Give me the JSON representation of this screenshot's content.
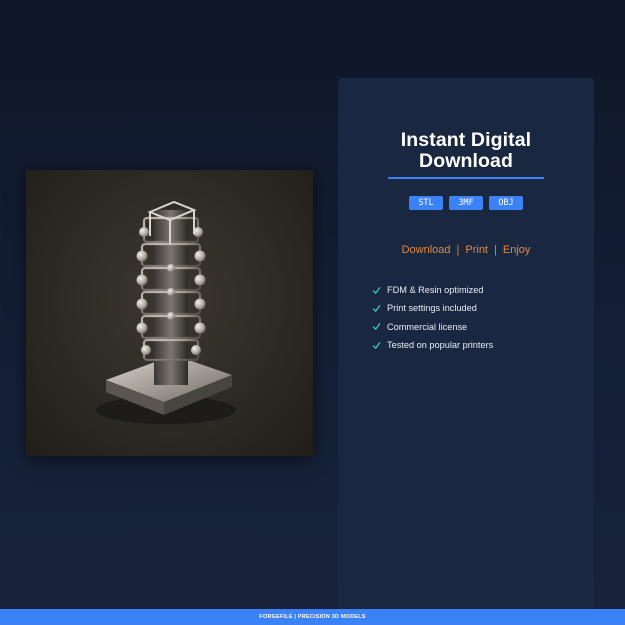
{
  "product_image": {
    "alt": "3D printed lattice tower model"
  },
  "card": {
    "title_line1": "Instant Digital",
    "title_line2": "Download",
    "formats": [
      "STL",
      "3MF",
      "OBJ"
    ],
    "actions": [
      "Download",
      "Print",
      "Enjoy"
    ],
    "features": [
      "FDM & Resin optimized",
      "Print settings included",
      "Commercial license",
      "Tested on popular printers"
    ]
  },
  "footer": {
    "text": "FORGEFILE | PRECISION 3D MODELS"
  },
  "colors": {
    "accent_blue": "#3b82f6",
    "accent_orange": "#e3883a",
    "check_teal": "#2dd4bf",
    "card_bg": "#1a2740",
    "page_bg": "#0e1628"
  }
}
